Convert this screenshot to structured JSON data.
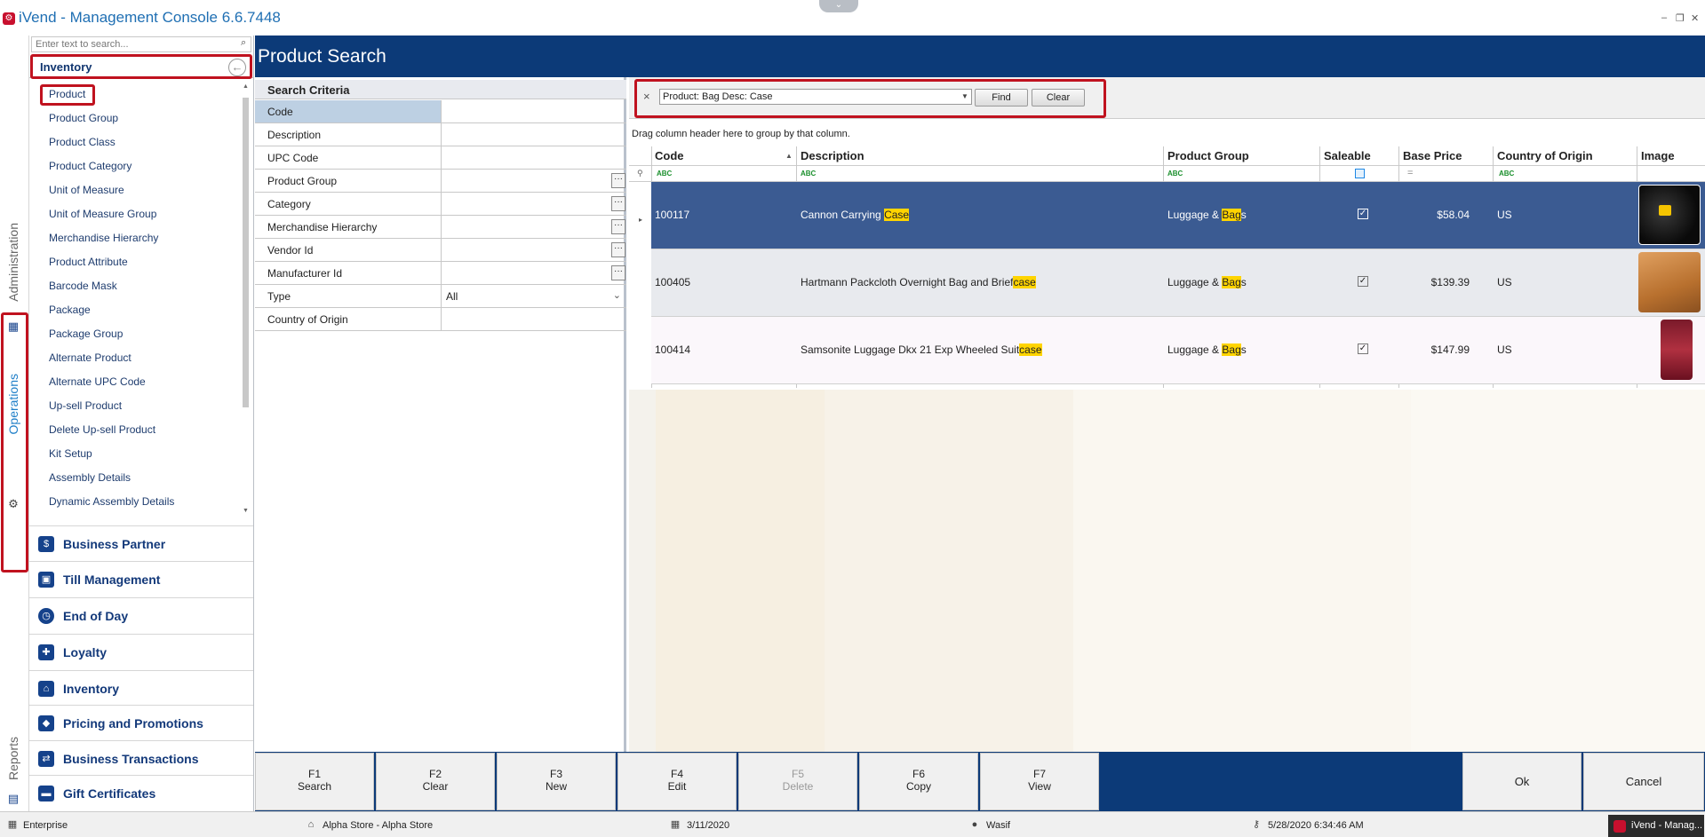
{
  "app": {
    "title": "iVend - Management Console 6.6.7448"
  },
  "rail": {
    "administration": "Administration",
    "operations": "Operations",
    "reports": "Reports"
  },
  "nav": {
    "search_placeholder": "Enter text to search...",
    "group_title": "Inventory",
    "items": [
      "Product",
      "Product Group",
      "Product Class",
      "Product Category",
      "Unit of Measure",
      "Unit of Measure Group",
      "Merchandise Hierarchy",
      "Product Attribute",
      "Barcode Mask",
      "Package",
      "Package Group",
      "Alternate Product",
      "Alternate UPC Code",
      "Up-sell Product",
      "Delete Up-sell Product",
      "Kit Setup",
      "Assembly Details",
      "Dynamic Assembly Details"
    ],
    "sections": [
      {
        "label": "Business Partner",
        "icon": "business-partner-icon"
      },
      {
        "label": "Till Management",
        "icon": "till-icon"
      },
      {
        "label": "End of Day",
        "icon": "clock-icon"
      },
      {
        "label": "Loyalty",
        "icon": "gift-icon"
      },
      {
        "label": "Inventory",
        "icon": "warehouse-icon"
      },
      {
        "label": "Pricing and Promotions",
        "icon": "tag-icon"
      },
      {
        "label": "Business Transactions",
        "icon": "transactions-icon"
      },
      {
        "label": "Gift Certificates",
        "icon": "certificate-icon"
      }
    ]
  },
  "header": {
    "title": "Product Search"
  },
  "criteria": {
    "title": "Search Criteria",
    "rows": [
      {
        "label": "Code",
        "value": ""
      },
      {
        "label": "Description",
        "value": ""
      },
      {
        "label": "UPC Code",
        "value": ""
      },
      {
        "label": "Product Group",
        "value": ""
      },
      {
        "label": "Category",
        "value": ""
      },
      {
        "label": "Merchandise Hierarchy",
        "value": ""
      },
      {
        "label": "Vendor Id",
        "value": ""
      },
      {
        "label": "Manufacturer Id",
        "value": ""
      },
      {
        "label": "Type",
        "value": "All"
      },
      {
        "label": "Country of Origin",
        "value": ""
      }
    ]
  },
  "find": {
    "query": "Product: Bag Desc: Case",
    "find_label": "Find",
    "clear_label": "Clear",
    "close": "×"
  },
  "grid": {
    "hint": "Drag column header here to group by that column.",
    "columns": [
      "Code",
      "Description",
      "Product Group",
      "Saleable",
      "Base Price",
      "Country of Origin",
      "Image"
    ],
    "rows": [
      {
        "code": "100117",
        "desc_pre": "Cannon Carrying ",
        "desc_hl": "Case",
        "desc_post": "",
        "group_pre": "Luggage & ",
        "group_hl": "Bag",
        "group_post": "s",
        "saleable": true,
        "price": "$58.04",
        "country": "US"
      },
      {
        "code": "100405",
        "desc_pre": "Hartmann Packcloth Overnight Bag and Brief",
        "desc_hl": "case",
        "desc_post": "",
        "group_pre": "Luggage & ",
        "group_hl": "Bag",
        "group_post": "s",
        "saleable": true,
        "price": "$139.39",
        "country": "US"
      },
      {
        "code": "100414",
        "desc_pre": "Samsonite Luggage Dkx 21 Exp Wheeled Suit",
        "desc_hl": "case",
        "desc_post": "",
        "group_pre": "Luggage & ",
        "group_hl": "Bag",
        "group_post": "s",
        "saleable": true,
        "price": "$147.99",
        "country": "US"
      }
    ]
  },
  "fkeys": [
    {
      "key": "F1",
      "label": "Search",
      "enabled": true
    },
    {
      "key": "F2",
      "label": "Clear",
      "enabled": true
    },
    {
      "key": "F3",
      "label": "New",
      "enabled": true
    },
    {
      "key": "F4",
      "label": "Edit",
      "enabled": true
    },
    {
      "key": "F5",
      "label": "Delete",
      "enabled": false
    },
    {
      "key": "F6",
      "label": "Copy",
      "enabled": true
    },
    {
      "key": "F7",
      "label": "View",
      "enabled": true
    }
  ],
  "actions": {
    "ok": "Ok",
    "cancel": "Cancel"
  },
  "status": {
    "edition": "Enterprise",
    "store": "Alpha Store - Alpha Store",
    "date": "3/11/2020",
    "user": "Wasif",
    "datetime": "5/28/2020 6:34:46 AM",
    "taskbar": "iVend - Manag..."
  },
  "colors": {
    "accent": "#0c3a78",
    "highlight": "#ffd400",
    "annotation": "#c0121f",
    "selected_row": "#3b5b92"
  }
}
